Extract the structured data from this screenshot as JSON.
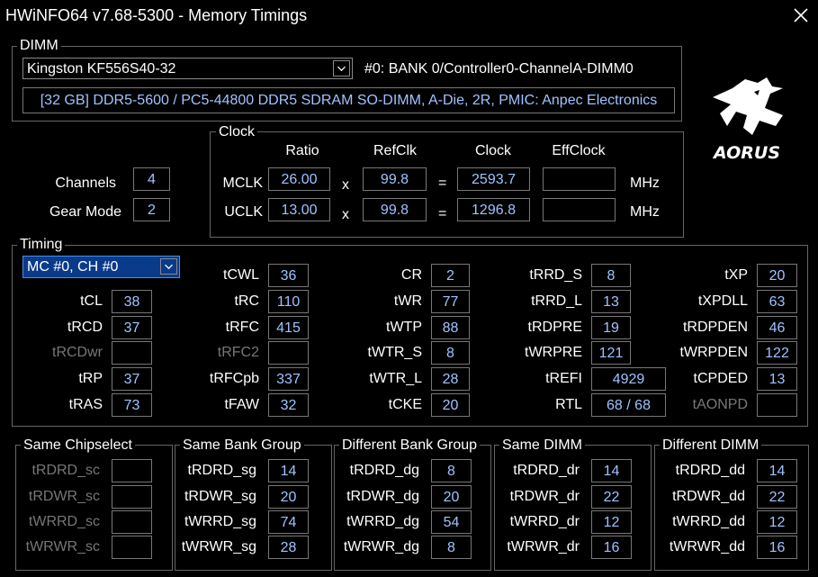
{
  "window": {
    "title": "HWiNFO64 v7.68-5300 - Memory Timings"
  },
  "dimm": {
    "group_label": "DIMM",
    "selected_module": "Kingston KF556S40-32",
    "location": "#0: BANK 0/Controller0-ChannelA-DIMM0",
    "description": "[32 GB] DDR5-5600 / PC5-44800 DDR5 SDRAM SO-DIMM, A-Die, 2R, PMIC: Anpec Electronics"
  },
  "logo_text": "AORUS",
  "config": {
    "channels_label": "Channels",
    "channels": "4",
    "gear_label": "Gear Mode",
    "gear": "2"
  },
  "clock": {
    "group_label": "Clock",
    "headers": {
      "ratio": "Ratio",
      "refclk": "RefClk",
      "clock": "Clock",
      "effclock": "EffClock"
    },
    "rows": [
      {
        "label": "MCLK",
        "ratio": "26.00",
        "times": "x",
        "refclk": "99.8",
        "equals": "=",
        "clock": "2593.7",
        "effclock": "",
        "unit": "MHz"
      },
      {
        "label": "UCLK",
        "ratio": "13.00",
        "times": "x",
        "refclk": "99.8",
        "equals": "=",
        "clock": "1296.8",
        "effclock": "",
        "unit": "MHz"
      }
    ]
  },
  "timing": {
    "group_label": "Timing",
    "selected_channel": "MC #0, CH #0",
    "col1": [
      {
        "label": "tCL",
        "value": "38",
        "dim": false
      },
      {
        "label": "tRCD",
        "value": "37",
        "dim": false
      },
      {
        "label": "tRCDwr",
        "value": "",
        "dim": true
      },
      {
        "label": "tRP",
        "value": "37",
        "dim": false
      },
      {
        "label": "tRAS",
        "value": "73",
        "dim": false
      }
    ],
    "col2": [
      {
        "label": "tCWL",
        "value": "36",
        "dim": false
      },
      {
        "label": "tRC",
        "value": "110",
        "dim": false
      },
      {
        "label": "tRFC",
        "value": "415",
        "dim": false
      },
      {
        "label": "tRFC2",
        "value": "",
        "dim": true
      },
      {
        "label": "tRFCpb",
        "value": "337",
        "dim": false
      },
      {
        "label": "tFAW",
        "value": "32",
        "dim": false
      }
    ],
    "col3": [
      {
        "label": "CR",
        "value": "2",
        "dim": false
      },
      {
        "label": "tWR",
        "value": "77",
        "dim": false
      },
      {
        "label": "tWTP",
        "value": "88",
        "dim": false
      },
      {
        "label": "tWTR_S",
        "value": "8",
        "dim": false
      },
      {
        "label": "tWTR_L",
        "value": "28",
        "dim": false
      },
      {
        "label": "tCKE",
        "value": "20",
        "dim": false
      }
    ],
    "col4": [
      {
        "label": "tRRD_S",
        "value": "8",
        "dim": false
      },
      {
        "label": "tRRD_L",
        "value": "13",
        "dim": false
      },
      {
        "label": "tRDPRE",
        "value": "19",
        "dim": false
      },
      {
        "label": "tWRPRE",
        "value": "121",
        "dim": false
      },
      {
        "label": "tREFI",
        "value": "4929",
        "dim": false
      },
      {
        "label": "RTL",
        "value": "68 / 68",
        "dim": false
      }
    ],
    "col5": [
      {
        "label": "tXP",
        "value": "20",
        "dim": false
      },
      {
        "label": "tXPDLL",
        "value": "63",
        "dim": false
      },
      {
        "label": "tRDPDEN",
        "value": "46",
        "dim": false
      },
      {
        "label": "tWRPDEN",
        "value": "122",
        "dim": false
      },
      {
        "label": "tCPDED",
        "value": "13",
        "dim": false
      },
      {
        "label": "tAONPD",
        "value": "",
        "dim": true
      }
    ]
  },
  "turnaround": [
    {
      "title": "Same Chipselect",
      "rows": [
        {
          "label": "tRDRD_sc",
          "value": "",
          "dim": true
        },
        {
          "label": "tRDWR_sc",
          "value": "",
          "dim": true
        },
        {
          "label": "tWRRD_sc",
          "value": "",
          "dim": true
        },
        {
          "label": "tWRWR_sc",
          "value": "",
          "dim": true
        }
      ]
    },
    {
      "title": "Same Bank Group",
      "rows": [
        {
          "label": "tRDRD_sg",
          "value": "14",
          "dim": false
        },
        {
          "label": "tRDWR_sg",
          "value": "20",
          "dim": false
        },
        {
          "label": "tWRRD_sg",
          "value": "74",
          "dim": false
        },
        {
          "label": "tWRWR_sg",
          "value": "28",
          "dim": false
        }
      ]
    },
    {
      "title": "Different Bank Group",
      "rows": [
        {
          "label": "tRDRD_dg",
          "value": "8",
          "dim": false
        },
        {
          "label": "tRDWR_dg",
          "value": "20",
          "dim": false
        },
        {
          "label": "tWRRD_dg",
          "value": "54",
          "dim": false
        },
        {
          "label": "tWRWR_dg",
          "value": "8",
          "dim": false
        }
      ]
    },
    {
      "title": "Same DIMM",
      "rows": [
        {
          "label": "tRDRD_dr",
          "value": "14",
          "dim": false
        },
        {
          "label": "tRDWR_dr",
          "value": "22",
          "dim": false
        },
        {
          "label": "tWRRD_dr",
          "value": "12",
          "dim": false
        },
        {
          "label": "tWRWR_dr",
          "value": "16",
          "dim": false
        }
      ]
    },
    {
      "title": "Different DIMM",
      "rows": [
        {
          "label": "tRDRD_dd",
          "value": "14",
          "dim": false
        },
        {
          "label": "tRDWR_dd",
          "value": "22",
          "dim": false
        },
        {
          "label": "tWRRD_dd",
          "value": "12",
          "dim": false
        },
        {
          "label": "tWRWR_dd",
          "value": "16",
          "dim": false
        }
      ]
    }
  ]
}
